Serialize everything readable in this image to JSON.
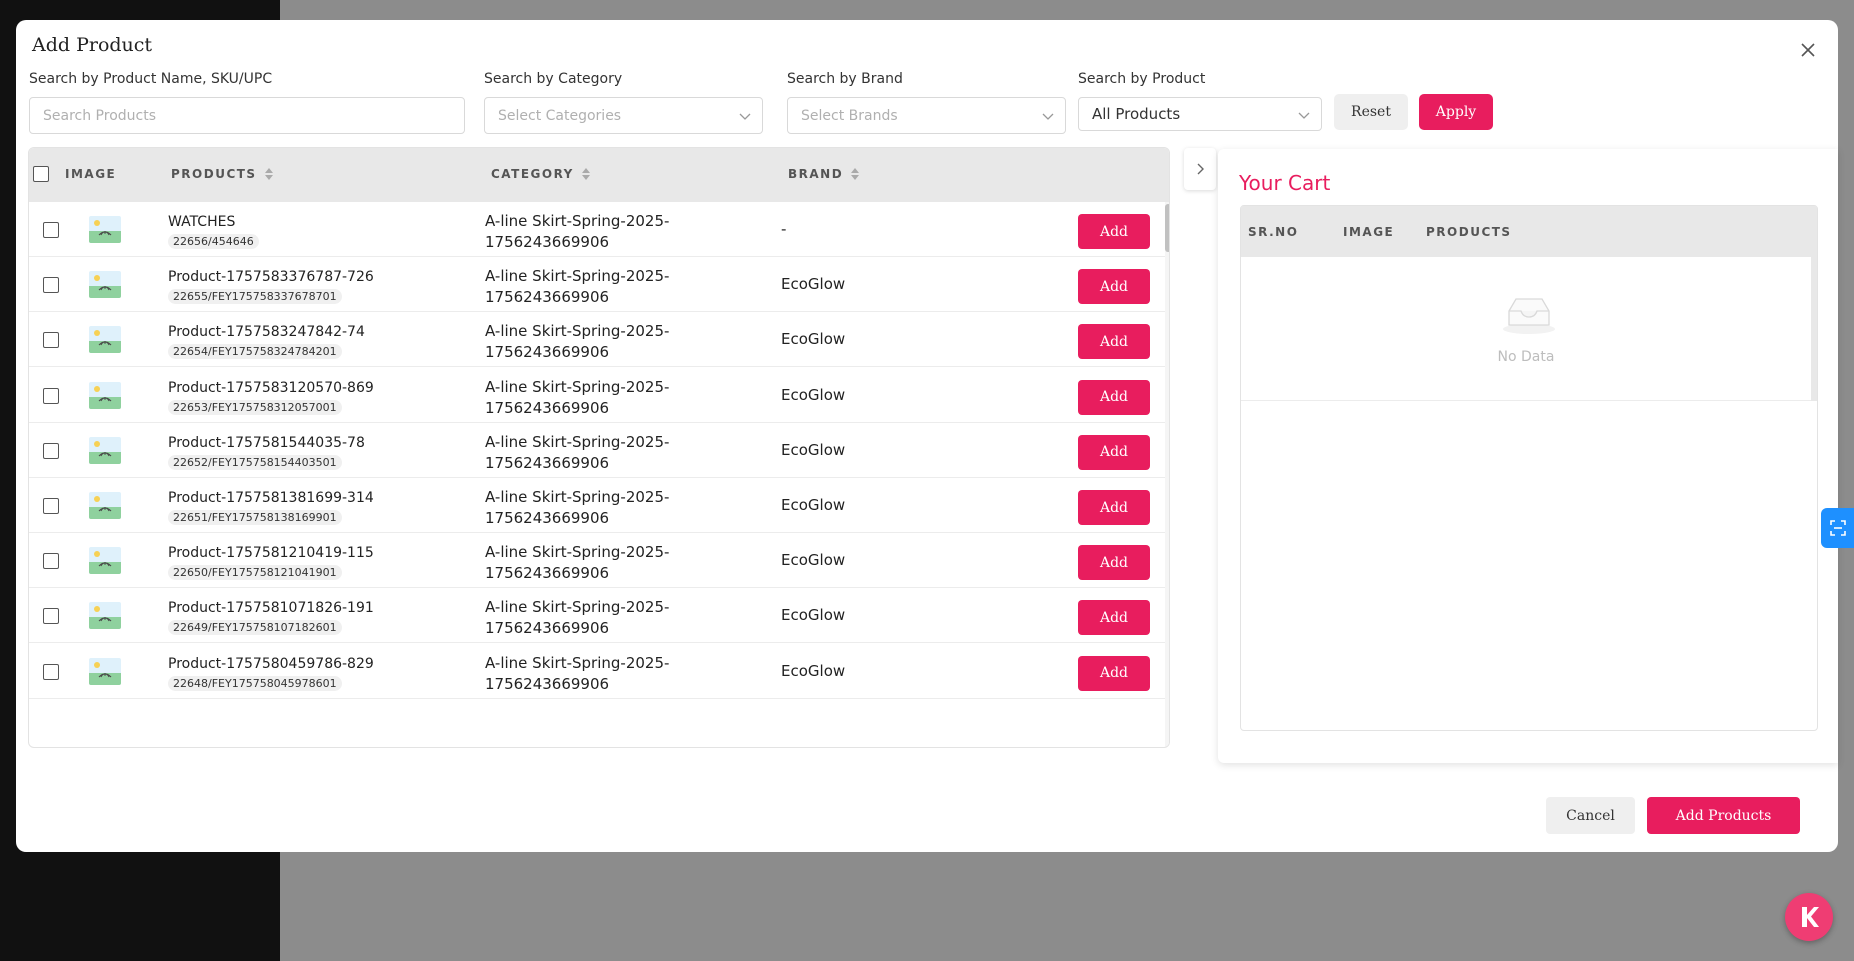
{
  "modal": {
    "title": "Add Product"
  },
  "filters": {
    "name_label": "Search by Product Name, SKU/UPC",
    "name_placeholder": "Search Products",
    "category_label": "Search by Category",
    "category_placeholder": "Select Categories",
    "brand_label": "Search by Brand",
    "brand_placeholder": "Select Brands",
    "product_label": "Search by Product",
    "product_value": "All Products",
    "reset_label": "Reset",
    "apply_label": "Apply"
  },
  "table": {
    "columns": [
      "IMAGE",
      "PRODUCTS",
      "CATEGORY",
      "BRAND"
    ],
    "add_label": "Add",
    "rows": [
      {
        "name": "WATCHES",
        "sku": "22656/454646",
        "category": [
          "A-line Skirt-Spring-2025-",
          "1756243669906"
        ],
        "brand": "-"
      },
      {
        "name": "Product-1757583376787-726",
        "sku": "22655/FEY175758337678701",
        "category": [
          "A-line Skirt-Spring-2025-",
          "1756243669906"
        ],
        "brand": "EcoGlow"
      },
      {
        "name": "Product-1757583247842-74",
        "sku": "22654/FEY175758324784201",
        "category": [
          "A-line Skirt-Spring-2025-",
          "1756243669906"
        ],
        "brand": "EcoGlow"
      },
      {
        "name": "Product-1757583120570-869",
        "sku": "22653/FEY175758312057001",
        "category": [
          "A-line Skirt-Spring-2025-",
          "1756243669906"
        ],
        "brand": "EcoGlow"
      },
      {
        "name": "Product-1757581544035-78",
        "sku": "22652/FEY175758154403501",
        "category": [
          "A-line Skirt-Spring-2025-",
          "1756243669906"
        ],
        "brand": "EcoGlow"
      },
      {
        "name": "Product-1757581381699-314",
        "sku": "22651/FEY175758138169901",
        "category": [
          "A-line Skirt-Spring-2025-",
          "1756243669906"
        ],
        "brand": "EcoGlow"
      },
      {
        "name": "Product-1757581210419-115",
        "sku": "22650/FEY175758121041901",
        "category": [
          "A-line Skirt-Spring-2025-",
          "1756243669906"
        ],
        "brand": "EcoGlow"
      },
      {
        "name": "Product-1757581071826-191",
        "sku": "22649/FEY175758107182601",
        "category": [
          "A-line Skirt-Spring-2025-",
          "1756243669906"
        ],
        "brand": "EcoGlow"
      },
      {
        "name": "Product-1757580459786-829",
        "sku": "22648/FEY175758045978601",
        "category": [
          "A-line Skirt-Spring-2025-",
          "1756243669906"
        ],
        "brand": "EcoGlow"
      }
    ]
  },
  "cart": {
    "title": "Your Cart",
    "columns": [
      "SR.NO",
      "IMAGE",
      "PRODUCTS"
    ],
    "empty_text": "No Data"
  },
  "footer": {
    "cancel_label": "Cancel",
    "add_products_label": "Add Products"
  },
  "colors": {
    "accent": "#e81d5e",
    "side_tab": "#1e90ff"
  },
  "icons": {
    "close": "close-icon",
    "chevron": "chevron-down-icon",
    "collapse": "chevron-right-icon",
    "image_placeholder": "image-placeholder-icon",
    "empty": "empty-inbox-icon",
    "side_tab": "scan-icon",
    "fab": "app-logo-icon"
  }
}
